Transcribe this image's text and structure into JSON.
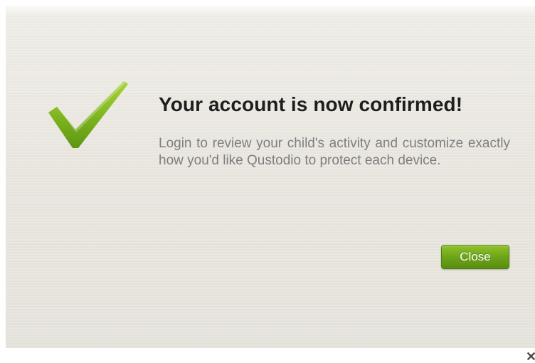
{
  "dialog": {
    "title": "Your account is now confirmed!",
    "message": "Login to review your child's activity and customize exactly how you'd like Qustodio to protect each device.",
    "icon": "checkmark-icon",
    "close_label": "Close",
    "dismiss_icon": "close-icon",
    "dismiss_glyph": "✕"
  },
  "colors": {
    "accent_green": "#6ea41a",
    "title_text": "#1e1e1e",
    "body_text": "#7e7e7e",
    "background": "#ebe8e1"
  }
}
